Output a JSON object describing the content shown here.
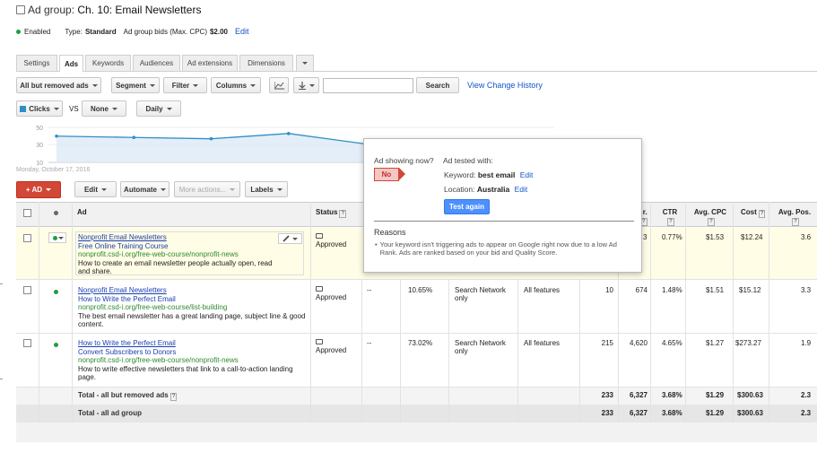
{
  "header": {
    "prefix": "Ad group:",
    "title": "Ch. 10: Email Newsletters",
    "status": "Enabled",
    "type_label": "Type:",
    "type_value": "Standard",
    "bids_label": "Ad group bids (Max. CPC)",
    "bids_value": "$2.00",
    "edit": "Edit"
  },
  "tabs": [
    "Settings",
    "Ads",
    "Keywords",
    "Audiences",
    "Ad extensions",
    "Dimensions"
  ],
  "toolbar": {
    "filter_scope": "All but removed ads",
    "segment": "Segment",
    "filter": "Filter",
    "columns": "Columns",
    "search_button": "Search",
    "search_placeholder": "",
    "view_history": "View Change History"
  },
  "chart_controls": {
    "metric1": "Clicks",
    "vs": "VS",
    "metric2": "None",
    "period": "Daily"
  },
  "chart_data": {
    "type": "line",
    "yticks": [
      "50",
      "30",
      "10"
    ],
    "ylim": [
      10,
      50
    ],
    "start_label": "Monday, October 17, 2016",
    "series": [
      {
        "values": [
          40,
          38.5,
          37,
          43,
          31
        ]
      }
    ]
  },
  "actions": {
    "new_ad": "+ AD",
    "edit": "Edit",
    "automate": "Automate",
    "more": "More actions...",
    "labels": "Labels"
  },
  "columns": {
    "ad": "Ad",
    "status": "Status",
    "ctr_partial": "r.",
    "ctr": "CTR",
    "avg_cpc": "Avg. CPC",
    "cost": "Cost",
    "avg_pos": "Avg. Pos."
  },
  "rows": [
    {
      "headline": "Nonprofit Email Newsletters",
      "line2": "Free Online Training Course",
      "url": "nonprofit.csd-i.org/free-web-course/nonprofit-news",
      "desc": "How to create an email newsletter people actually open, read and share.",
      "status": "Approved",
      "dash": "",
      "pct": "",
      "network": "",
      "devices": "",
      "clicks": "",
      "impr": "3",
      "ctr": "0.77%",
      "cpc": "$1.53",
      "cost": "$12.24",
      "pos": "3.6"
    },
    {
      "headline": "Nonprofit Email Newsletters",
      "line2": "How to Write the Perfect Email",
      "url": "nonprofit.csd-i.org/free-web-course/list-building",
      "desc": "The best email newsletter has a great landing page, subject line & good content.",
      "status": "Approved",
      "dash": "--",
      "pct": "10.65%",
      "network": "Search Network only",
      "devices": "All features",
      "clicks": "10",
      "impr": "674",
      "ctr": "1.48%",
      "cpc": "$1.51",
      "cost": "$15.12",
      "pos": "3.3"
    },
    {
      "headline": "How to Write the Perfect Email",
      "line2": "Convert Subscribers to Donors",
      "url": "nonprofit.csd-i.org/free-web-course/nonprofit-news",
      "desc": "How to write effective newsletters that link to a call-to-action landing page.",
      "status": "Approved",
      "dash": "--",
      "pct": "73.02%",
      "network": "Search Network only",
      "devices": "All features",
      "clicks": "215",
      "impr": "4,620",
      "ctr": "4.65%",
      "cpc": "$1.27",
      "cost": "$273.27",
      "pos": "1.9"
    }
  ],
  "totals": [
    {
      "label": "Total - all but removed ads",
      "clicks": "233",
      "impr": "6,327",
      "ctr": "3.68%",
      "cpc": "$1.29",
      "cost": "$300.63",
      "pos": "2.3"
    },
    {
      "label": "Total - all ad group",
      "clicks": "233",
      "impr": "6,327",
      "ctr": "3.68%",
      "cpc": "$1.29",
      "cost": "$300.63",
      "pos": "2.3"
    }
  ],
  "popup": {
    "showing_q": "Ad showing now?",
    "tested_with": "Ad tested with:",
    "answer": "No",
    "keyword_label": "Keyword:",
    "keyword_value": "best email",
    "location_label": "Location:",
    "location_value": "Australia",
    "edit": "Edit",
    "test_again": "Test again",
    "reasons_title": "Reasons",
    "reason": "Your keyword isn't triggering ads to appear on Google right now due to a low Ad Rank. Ads are ranked based on your bid and Quality Score."
  },
  "colors": {
    "accent_red": "#d14836",
    "link_blue": "#1a3fb0",
    "url_green": "#2d8a2d",
    "status_green": "#1e9e3e",
    "test_button": "#4d90fe",
    "chart_line": "#2e8fc7"
  }
}
